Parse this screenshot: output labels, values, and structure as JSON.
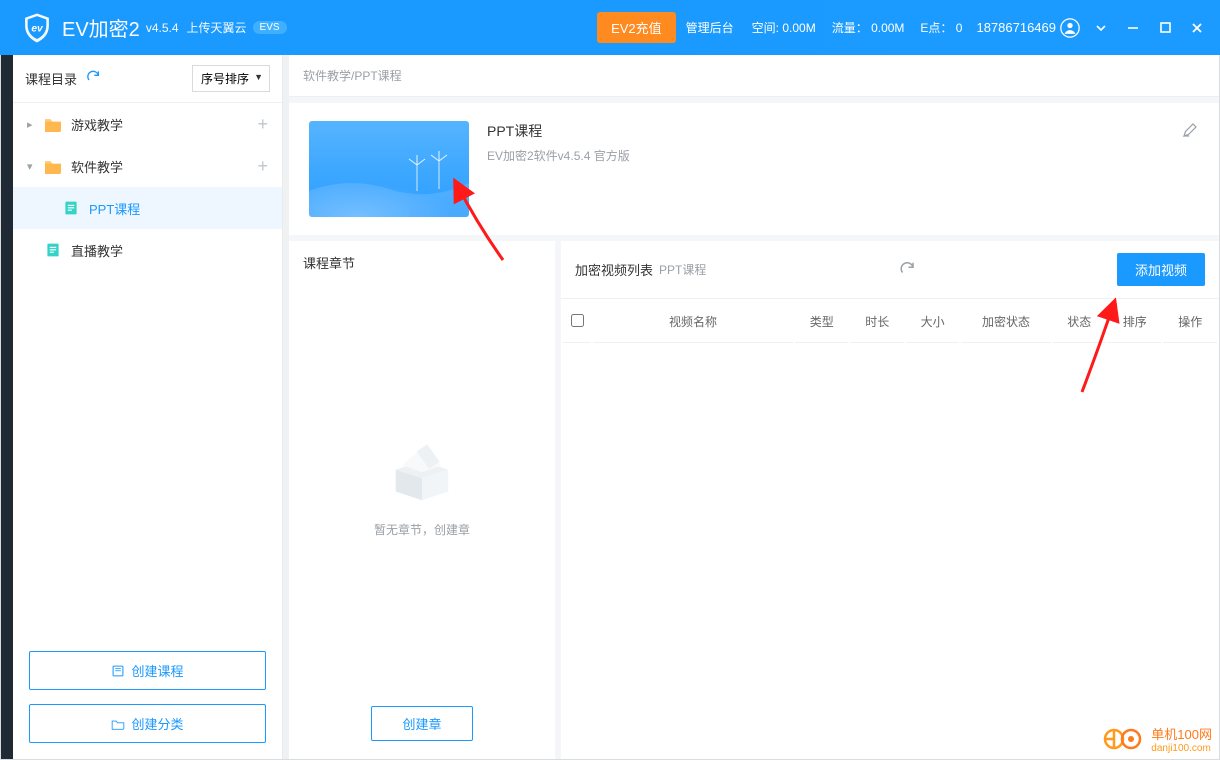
{
  "titlebar": {
    "app_name": "EV加密2",
    "version": "v4.5.4",
    "upload_hint": "上传天翼云",
    "evs": "EVS",
    "recharge": "EV2充值",
    "admin": "管理后台",
    "space_label": "空间:",
    "space_value": "0.00M",
    "traffic_label": "流量：",
    "traffic_value": "0.00M",
    "epoint_label": "E点：",
    "epoint_value": "0",
    "phone": "18786716469"
  },
  "sidebar": {
    "title": "课程目录",
    "sort": "序号排序",
    "items": [
      {
        "label": "游戏教学",
        "type": "folder",
        "expanded": false,
        "color": "#ffb84d"
      },
      {
        "label": "软件教学",
        "type": "folder",
        "expanded": true,
        "color": "#ffb84d"
      },
      {
        "label": "PPT课程",
        "type": "doc",
        "selected": true,
        "color": "#33d3c8"
      },
      {
        "label": "直播教学",
        "type": "doc",
        "color": "#33d3c8"
      }
    ],
    "create_course": "创建课程",
    "create_category": "创建分类"
  },
  "breadcrumb": "软件教学/PPT课程",
  "course": {
    "title": "PPT课程",
    "subtitle": "EV加密2软件v4.5.4 官方版"
  },
  "chapter_panel": {
    "title": "课程章节",
    "empty": "暂无章节，创建章",
    "create_btn": "创建章"
  },
  "video_panel": {
    "title": "加密视频列表",
    "subtitle": "PPT课程",
    "add_btn": "添加视频",
    "columns": [
      "视频名称",
      "类型",
      "时长",
      "大小",
      "加密状态",
      "状态",
      "排序",
      "操作"
    ]
  },
  "watermark": {
    "name": "单机100网",
    "domain": "danji100.com"
  }
}
